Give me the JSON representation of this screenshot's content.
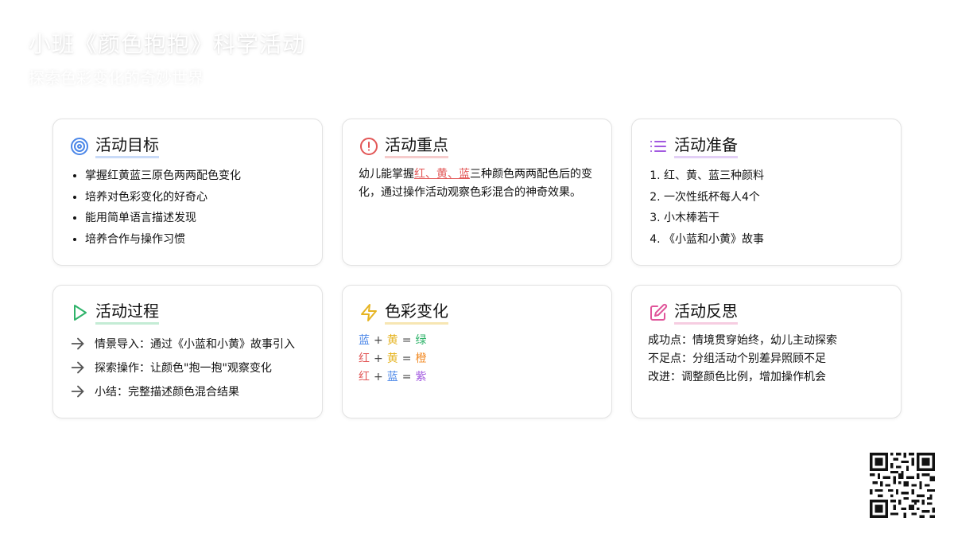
{
  "header": {
    "title": "小班《颜色抱抱》科学活动",
    "subtitle": "探索色彩变化的奇妙世界"
  },
  "cards": {
    "goals": {
      "title": "活动目标",
      "icon": "target-icon",
      "accent": "#4a86e8",
      "items": [
        "掌握红黄蓝三原色两两配色变化",
        "培养对色彩变化的好奇心",
        "能用简单语言描述发现",
        "培养合作与操作习惯"
      ]
    },
    "focus": {
      "title": "活动重点",
      "icon": "alert-circle-icon",
      "accent": "#e25656",
      "text_before": "幼儿能掌握",
      "text_highlight": "红、黄、蓝",
      "text_after": "三种颜色两两配色后的变化，通过操作活动观察色彩混合的神奇效果。"
    },
    "prep": {
      "title": "活动准备",
      "icon": "list-icon",
      "accent": "#a259e0",
      "items": [
        "红、黄、蓝三种颜料",
        "一次性纸杯每人4个",
        "小木棒若干",
        "《小蓝和小黄》故事"
      ]
    },
    "process": {
      "title": "活动过程",
      "icon": "play-icon",
      "accent": "#2fb36a",
      "steps": [
        "情景导入：通过《小蓝和小黄》故事引入",
        "探索操作：让颜色\"抱一抱\"观察变化",
        "小结：完整描述颜色混合结果"
      ]
    },
    "colors": {
      "title": "色彩变化",
      "icon": "lightning-icon",
      "accent": "#e6b422",
      "mixes": [
        {
          "a": "蓝",
          "a_color": "#4a86e8",
          "b": "黄",
          "b_color": "#e6b422",
          "r": "绿",
          "r_color": "#2fb36a"
        },
        {
          "a": "红",
          "a_color": "#e25656",
          "b": "黄",
          "b_color": "#e6b422",
          "r": "橙",
          "r_color": "#f28c28"
        },
        {
          "a": "红",
          "a_color": "#e25656",
          "b": "蓝",
          "b_color": "#4a86e8",
          "r": "紫",
          "r_color": "#a259e0"
        }
      ],
      "plus": "+",
      "equals": "="
    },
    "reflect": {
      "title": "活动反思",
      "icon": "edit-icon",
      "accent": "#e0559a",
      "lines": [
        "成功点：情境贯穿始终，幼儿主动探索",
        "不足点：分组活动个别差异照顾不足",
        "改进：调整颜色比例，增加操作机会"
      ]
    }
  }
}
